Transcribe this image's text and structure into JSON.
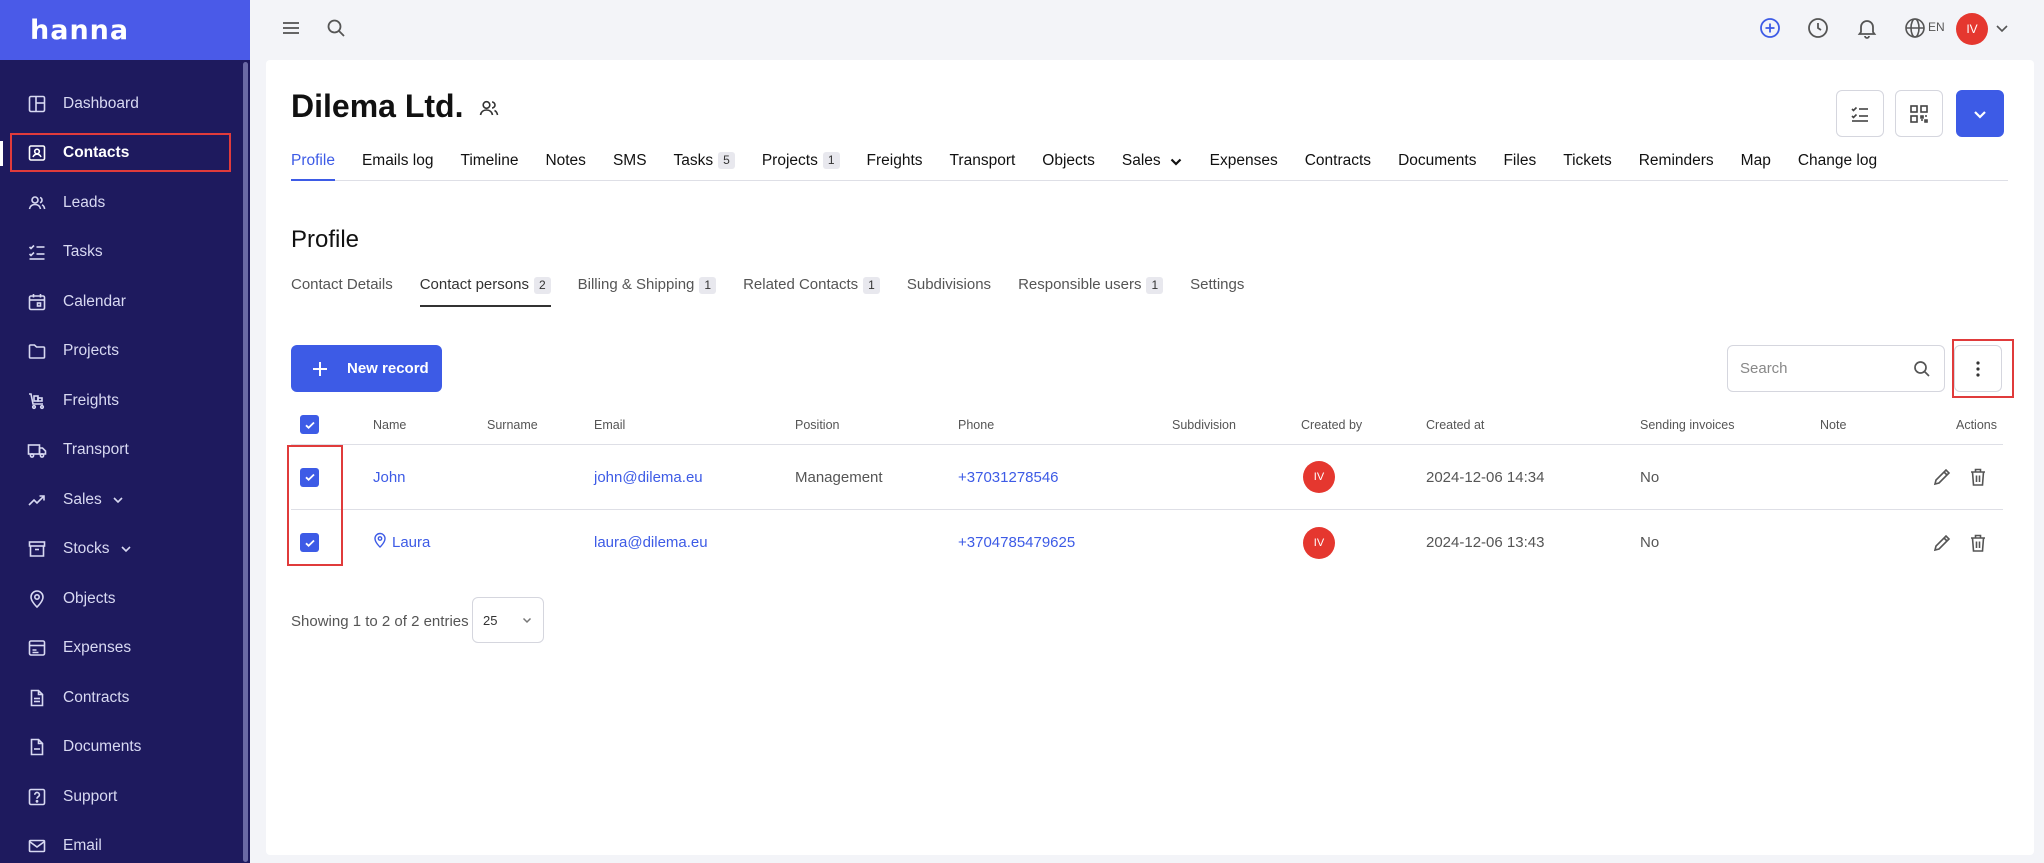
{
  "brand": {
    "logo": "hanna"
  },
  "sidebar": {
    "items": [
      {
        "label": "Dashboard",
        "icon": "dashboard-icon"
      },
      {
        "label": "Contacts",
        "icon": "contacts-icon",
        "active": true
      },
      {
        "label": "Leads",
        "icon": "leads-icon"
      },
      {
        "label": "Tasks",
        "icon": "tasks-icon"
      },
      {
        "label": "Calendar",
        "icon": "calendar-icon"
      },
      {
        "label": "Projects",
        "icon": "folder-icon"
      },
      {
        "label": "Freights",
        "icon": "freights-icon"
      },
      {
        "label": "Transport",
        "icon": "truck-icon"
      },
      {
        "label": "Sales",
        "icon": "trend-icon",
        "expandable": true
      },
      {
        "label": "Stocks",
        "icon": "stocks-icon",
        "expandable": true
      },
      {
        "label": "Objects",
        "icon": "pin-icon"
      },
      {
        "label": "Expenses",
        "icon": "expenses-icon"
      },
      {
        "label": "Contracts",
        "icon": "contract-icon"
      },
      {
        "label": "Documents",
        "icon": "document-icon"
      },
      {
        "label": "Support",
        "icon": "help-icon"
      },
      {
        "label": "Email",
        "icon": "mail-icon"
      }
    ]
  },
  "topbar": {
    "language": "EN",
    "user_initials": "IV"
  },
  "page": {
    "title": "Dilema Ltd.",
    "tabs": [
      {
        "label": "Profile",
        "active": true
      },
      {
        "label": "Emails log"
      },
      {
        "label": "Timeline"
      },
      {
        "label": "Notes"
      },
      {
        "label": "SMS"
      },
      {
        "label": "Tasks",
        "badge": "5"
      },
      {
        "label": "Projects",
        "badge": "1"
      },
      {
        "label": "Freights"
      },
      {
        "label": "Transport"
      },
      {
        "label": "Objects"
      },
      {
        "label": "Sales",
        "dropdown": true
      },
      {
        "label": "Expenses"
      },
      {
        "label": "Contracts"
      },
      {
        "label": "Documents"
      },
      {
        "label": "Files"
      },
      {
        "label": "Tickets"
      },
      {
        "label": "Reminders"
      },
      {
        "label": "Map"
      },
      {
        "label": "Change log"
      }
    ]
  },
  "profile": {
    "section_title": "Profile",
    "subtabs": [
      {
        "label": "Contact Details"
      },
      {
        "label": "Contact persons",
        "badge": "2",
        "active": true
      },
      {
        "label": "Billing & Shipping",
        "badge": "1"
      },
      {
        "label": "Related Contacts",
        "badge": "1"
      },
      {
        "label": "Subdivisions"
      },
      {
        "label": "Responsible users",
        "badge": "1"
      },
      {
        "label": "Settings"
      }
    ],
    "new_record_label": "New record",
    "search_placeholder": "Search"
  },
  "table": {
    "columns": [
      "Name",
      "Surname",
      "Email",
      "Position",
      "Phone",
      "Subdivision",
      "Created by",
      "Created at",
      "Sending invoices",
      "Note",
      "Actions"
    ],
    "rows": [
      {
        "name": "John",
        "surname": "",
        "email": "john@dilema.eu",
        "position": "Management",
        "phone": "+37031278546",
        "subdivision": "",
        "created_by": "IV",
        "created_at": "2024-12-06 14:34",
        "sending_invoices": "No",
        "note": "",
        "has_pin": false
      },
      {
        "name": "Laura",
        "surname": "",
        "email": "laura@dilema.eu",
        "position": "",
        "phone": "+3704785479625",
        "subdivision": "",
        "created_by": "IV",
        "created_at": "2024-12-06 13:43",
        "sending_invoices": "No",
        "note": "",
        "has_pin": true
      }
    ],
    "footer_text": "Showing 1 to 2 of 2 entries",
    "page_size": "25"
  }
}
